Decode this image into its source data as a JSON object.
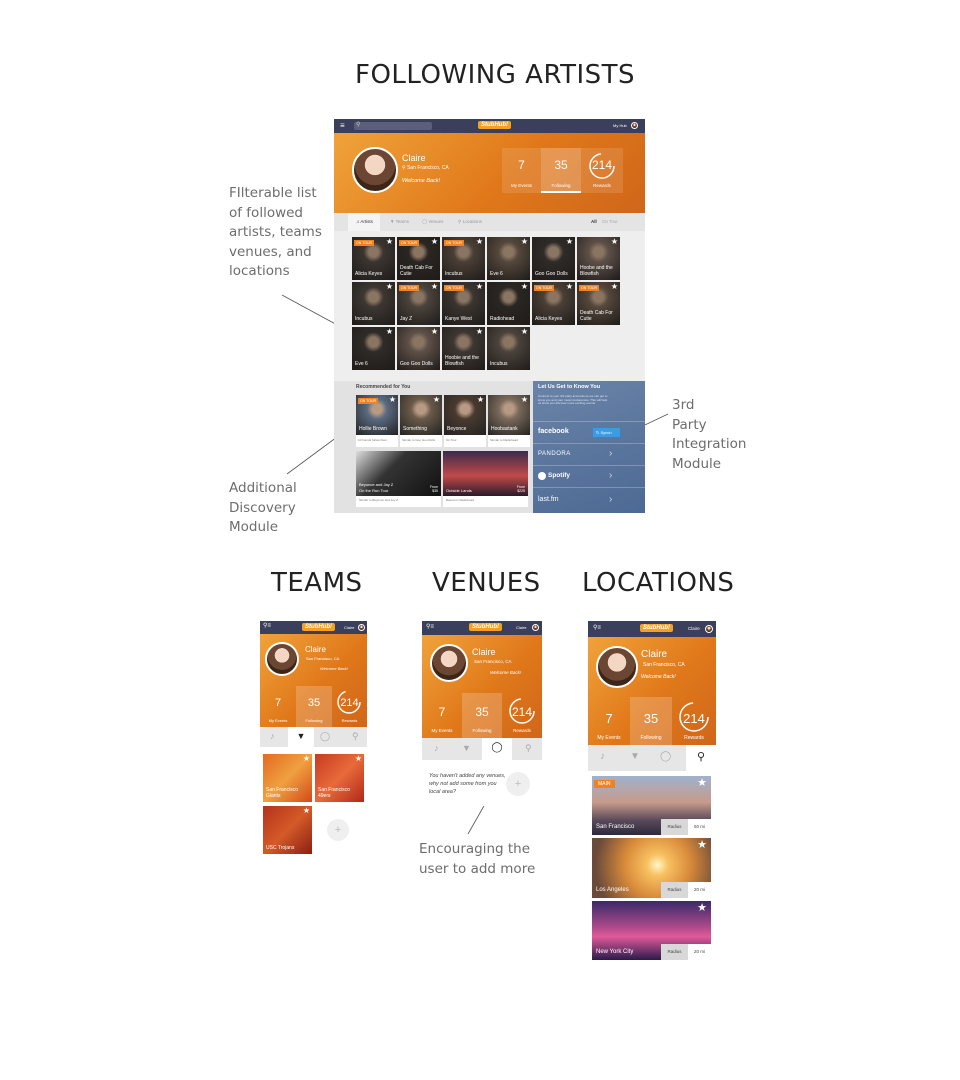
{
  "titles": {
    "following": "FOLLOWING ARTISTS",
    "teams": "TEAMS",
    "venues": "VENUES",
    "locations": "LOCATIONS"
  },
  "annotations": {
    "filterable": [
      "FIlterable list",
      "of followed",
      "artists, teams",
      "venues, and",
      "locations"
    ],
    "third_party": [
      "3rd",
      "Party",
      "Integration",
      "Module"
    ],
    "discovery": [
      "Additional",
      "Discovery",
      "Module"
    ],
    "encourage": [
      "Encouraging the",
      "user to add more"
    ]
  },
  "app": {
    "logo": "StubHub!",
    "my_hub": "My Hub",
    "user_short": "Claire",
    "profile": {
      "name": "Claire",
      "location": "San Francisco, CA",
      "welcome": "Welcome Back!"
    },
    "stats": [
      {
        "value": "7",
        "label": "My Events"
      },
      {
        "value": "35",
        "label": "Following"
      },
      {
        "value": "214",
        "label": "Rewards"
      }
    ],
    "tabs": [
      "Artists",
      "Teams",
      "Venues",
      "Locations"
    ],
    "filters": [
      "All",
      "On Tour"
    ],
    "on_tour_badge": "ON TOUR",
    "artists": [
      {
        "name": "Alicia Keyes",
        "tour": true
      },
      {
        "name": "Death Cab For Cutie",
        "tour": true
      },
      {
        "name": "Incubus",
        "tour": true
      },
      {
        "name": "Eve 6",
        "tour": false
      },
      {
        "name": "Goo Goo Dolls",
        "tour": false
      },
      {
        "name": "Hoobe and the Blowfish",
        "tour": false
      },
      {
        "name": "Incubus",
        "tour": false
      },
      {
        "name": "Jay Z",
        "tour": true
      },
      {
        "name": "Kanye West",
        "tour": true
      },
      {
        "name": "Radiohead",
        "tour": false
      },
      {
        "name": "Alicia Keyes",
        "tour": true
      },
      {
        "name": "Death Cab For Cutie",
        "tour": true
      },
      {
        "name": "Eve 6",
        "tour": false
      },
      {
        "name": "Goo Goo Dolls",
        "tour": false
      },
      {
        "name": "Hoobie and the Blowfish",
        "tour": false
      },
      {
        "name": "Incubus",
        "tour": false
      }
    ],
    "recommended_title": "Recommended for You",
    "recommended": [
      {
        "name": "Hollie Brown",
        "sub": "10 friends follow them"
      },
      {
        "name": "Something",
        "sub": "Similar to Goo Goo Dolls"
      },
      {
        "name": "Beyonce",
        "sub": "On Tour"
      },
      {
        "name": "Hoobastank",
        "sub": "Similar to Radiohead"
      }
    ],
    "recommended_wide": [
      {
        "name": "Beyonce and Jay Z On the Run Tour",
        "price": "From $35",
        "sub": "Similar to Beyonce and Jay Z"
      },
      {
        "name": "Outside Lands",
        "price": "From $225",
        "sub": "Based on Radiohead"
      }
    ],
    "know_title": "Let Us Get to Know You",
    "know_body": "Connect to your 3rd party accounts so we can get to know you and your music preferences. This will help us show you discover more exciting events.",
    "services": [
      "facebook",
      "PANDORA",
      "Spotify",
      "last.fm"
    ],
    "sync_label": "Synch"
  },
  "teams": [
    {
      "name": "San Francisco Giants"
    },
    {
      "name": "San Francisco 49ers"
    },
    {
      "name": "USC Trojans"
    }
  ],
  "venues": {
    "empty_text": "You haven't added any venues, why not add some from you local area?"
  },
  "locations": [
    {
      "name": "San Francisco",
      "radius_label": "Radius",
      "radius": "50 mi",
      "main": "MAIN"
    },
    {
      "name": "Los Angeles",
      "radius_label": "Radius",
      "radius": "20 mi"
    },
    {
      "name": "New York City",
      "radius_label": "Radius",
      "radius": "20 mi"
    }
  ]
}
